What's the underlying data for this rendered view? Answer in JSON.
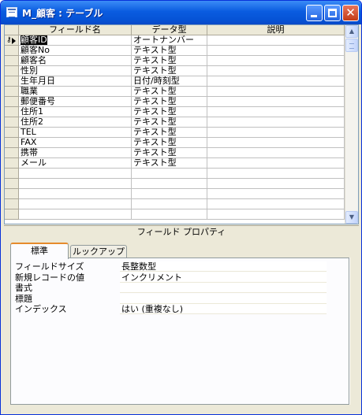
{
  "window": {
    "title": "M_顧客 : テーブル",
    "buttons": {
      "minimize": "minimize",
      "maximize": "maximize",
      "close": "✕"
    }
  },
  "grid": {
    "columns": [
      "フィールド名",
      "データ型",
      "説明"
    ],
    "rows": [
      {
        "field": "顧客ID",
        "type": "オートナンバー",
        "desc": "",
        "primary_key": true,
        "current": true
      },
      {
        "field": "顧客No",
        "type": "テキスト型",
        "desc": ""
      },
      {
        "field": "顧客名",
        "type": "テキスト型",
        "desc": ""
      },
      {
        "field": "性別",
        "type": "テキスト型",
        "desc": ""
      },
      {
        "field": "生年月日",
        "type": "日付/時刻型",
        "desc": ""
      },
      {
        "field": "職業",
        "type": "テキスト型",
        "desc": ""
      },
      {
        "field": "郵便番号",
        "type": "テキスト型",
        "desc": ""
      },
      {
        "field": "住所1",
        "type": "テキスト型",
        "desc": ""
      },
      {
        "field": "住所2",
        "type": "テキスト型",
        "desc": ""
      },
      {
        "field": "TEL",
        "type": "テキスト型",
        "desc": ""
      },
      {
        "field": "FAX",
        "type": "テキスト型",
        "desc": ""
      },
      {
        "field": "携帯",
        "type": "テキスト型",
        "desc": ""
      },
      {
        "field": "メール",
        "type": "テキスト型",
        "desc": ""
      },
      {
        "field": "",
        "type": "",
        "desc": ""
      },
      {
        "field": "",
        "type": "",
        "desc": ""
      },
      {
        "field": "",
        "type": "",
        "desc": ""
      },
      {
        "field": "",
        "type": "",
        "desc": ""
      },
      {
        "field": "",
        "type": "",
        "desc": ""
      }
    ]
  },
  "properties": {
    "caption": "フィールド プロパティ",
    "tabs": [
      "標準",
      "ルックアップ"
    ],
    "active_tab": "標準",
    "items": [
      {
        "label": "フィールドサイズ",
        "value": "長整数型"
      },
      {
        "label": "新規レコードの値",
        "value": "インクリメント"
      },
      {
        "label": "書式",
        "value": ""
      },
      {
        "label": "標題",
        "value": ""
      },
      {
        "label": "インデックス",
        "value": "はい (重複なし)"
      }
    ]
  },
  "colors": {
    "title_bar": "#0a5ce0",
    "window_face": "#ece9d8",
    "active_tab_accent": "#e68b2c",
    "selection": "#000000"
  }
}
